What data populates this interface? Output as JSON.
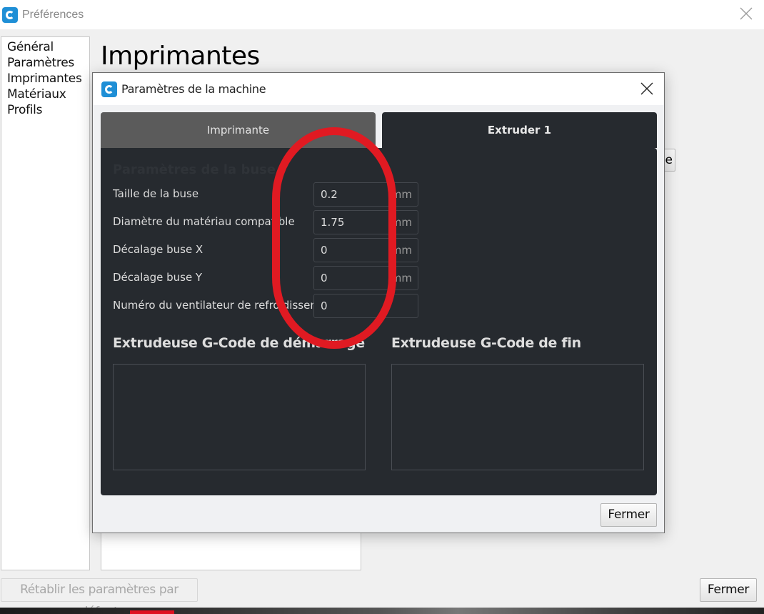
{
  "window": {
    "title": "Préférences",
    "icon": "cura-logo-icon",
    "close_icon": "close-icon"
  },
  "sidebar": {
    "items": [
      {
        "label": "Général"
      },
      {
        "label": "Paramètres"
      },
      {
        "label": "Imprimantes"
      },
      {
        "label": "Matériaux"
      },
      {
        "label": "Profils"
      }
    ]
  },
  "page": {
    "title": "Imprimantes",
    "hidden_button_partial": "e",
    "reset_button": "Rétablir les paramètres par défaut",
    "close_button": "Fermer"
  },
  "dialog": {
    "title": "Paramètres de la machine",
    "tabs": [
      {
        "label": "Imprimante",
        "active": false
      },
      {
        "label": "Extruder 1",
        "active": true
      }
    ],
    "section_title": "Paramètres de la buse",
    "fields": [
      {
        "label": "Taille de la buse",
        "value": "0.2",
        "unit": "mm"
      },
      {
        "label": "Diamètre du matériau compatible",
        "value": "1.75",
        "unit": "mm"
      },
      {
        "label": "Décalage buse X",
        "value": "0",
        "unit": "mm"
      },
      {
        "label": "Décalage buse Y",
        "value": "0",
        "unit": "mm"
      },
      {
        "label": "Numéro du ventilateur de refroidissement",
        "value": "0",
        "unit": ""
      }
    ],
    "start_gcode_title": "Extrudeuse G-Code de démarrage",
    "start_gcode_value": "",
    "end_gcode_title": "Extrudeuse G-Code de fin",
    "end_gcode_value": "",
    "close_button": "Fermer"
  },
  "colors": {
    "accent_logo": "#1f8fd6",
    "panel_bg": "#262a2f",
    "inactive_tab": "#5b5b5b",
    "annotation": "#e01a22"
  }
}
